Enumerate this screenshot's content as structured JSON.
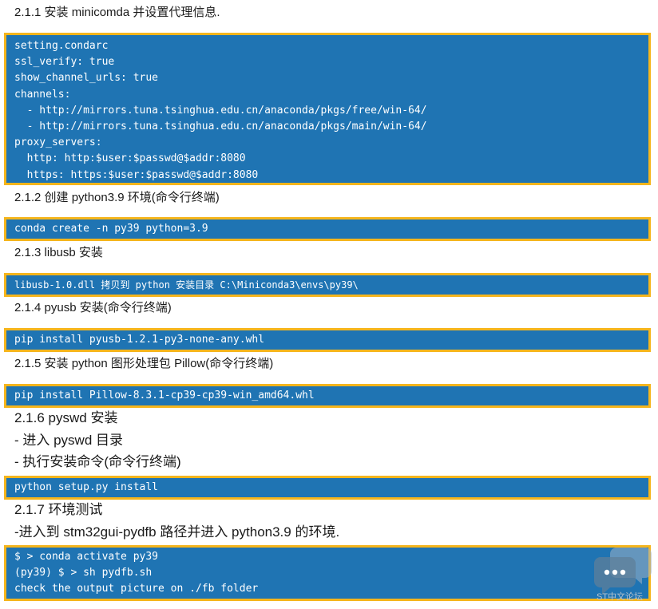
{
  "sections": {
    "s211": "2.1.1 安装 minicomda 并设置代理信息.",
    "s212": "2.1.2 创建 python3.9 环境(命令行终端)",
    "s213": "2.1.3 libusb 安装",
    "s214": "2.1.4 pyusb 安装(命令行终端)",
    "s215": "2.1.5 安装 python 图形处理包 Pillow(命令行终端)",
    "s216": "2.1.6 pyswd 安装",
    "s216_step1": "- 进入 pyswd 目录",
    "s216_step2": "- 执行安装命令(命令行终端)",
    "s217": "2.1.7 环境测试",
    "s217_step1": "-进入到 stm32gui-pydfb 路径并进入 python3.9 的环境."
  },
  "code_blocks": {
    "condarc": [
      "setting.condarc",
      "ssl_verify: true",
      "show_channel_urls: true",
      "channels:",
      "  - http://mirrors.tuna.tsinghua.edu.cn/anaconda/pkgs/free/win-64/",
      "  - http://mirrors.tuna.tsinghua.edu.cn/anaconda/pkgs/main/win-64/",
      "proxy_servers:",
      "  http: http:$user:$passwd@$addr:8080",
      "  https: https:$user:$passwd@$addr:8080"
    ],
    "conda_create": "conda create -n py39 python=3.9",
    "libusb": "libusb-1.0.dll 拷贝到 python 安装目录 C:\\Miniconda3\\envs\\py39\\",
    "pyusb": "pip install pyusb-1.2.1-py3-none-any.whl",
    "pillow": "pip install Pillow-8.3.1-cp39-cp39-win_amd64.whl",
    "pyswd": "python setup.py install",
    "test": [
      "$ > conda activate py39",
      "(py39) $ > sh pydfb.sh",
      "check the output picture on ./fb folder"
    ]
  },
  "watermark": {
    "text": "ST中文论坛",
    "icon": "chat-bubbles-icon"
  },
  "colors": {
    "code_bg": "#1f74b3",
    "code_border": "#f5b51c",
    "code_text": "#ffffff"
  }
}
